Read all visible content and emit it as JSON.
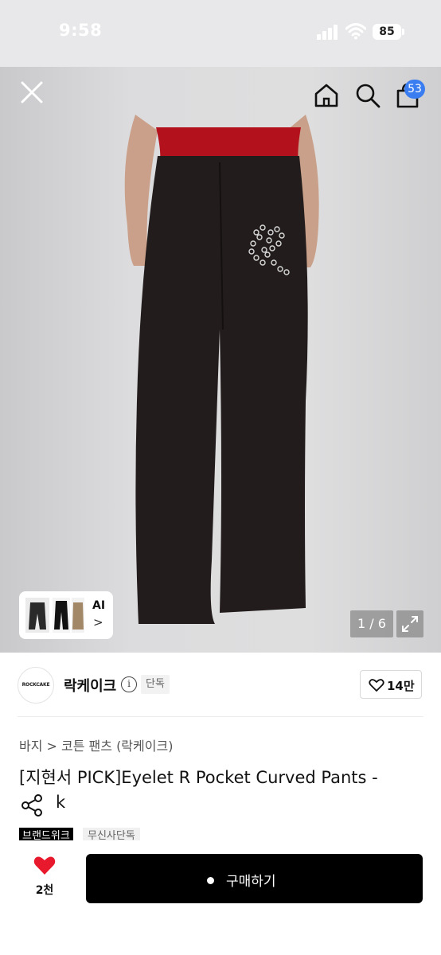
{
  "status_bar": {
    "time": "9:58",
    "battery": "85"
  },
  "nav": {
    "cart_count": "53"
  },
  "gallery": {
    "page_indicator": "1 / 6",
    "ai_label": "AI",
    "ai_chevron": ">"
  },
  "brand": {
    "logo_text": "ROCKCAKE",
    "name": "락케이크",
    "exclusive_badge": "단독",
    "like_count": "14만"
  },
  "breadcrumb": "바지 > 코튼 팬츠 (락케이크)",
  "product": {
    "title_line1": "[지현서 PICK]Eyelet R Pocket Curved Pants -",
    "title_line2": "k"
  },
  "tags": [
    "브랜드위크",
    "무신사단독"
  ],
  "bottom": {
    "heart_count": "2천",
    "buy_label": "구매하기"
  },
  "colors": {
    "accent_blue": "#3a7df0",
    "heart_red": "#e8192c",
    "buy_button": "#000000"
  }
}
